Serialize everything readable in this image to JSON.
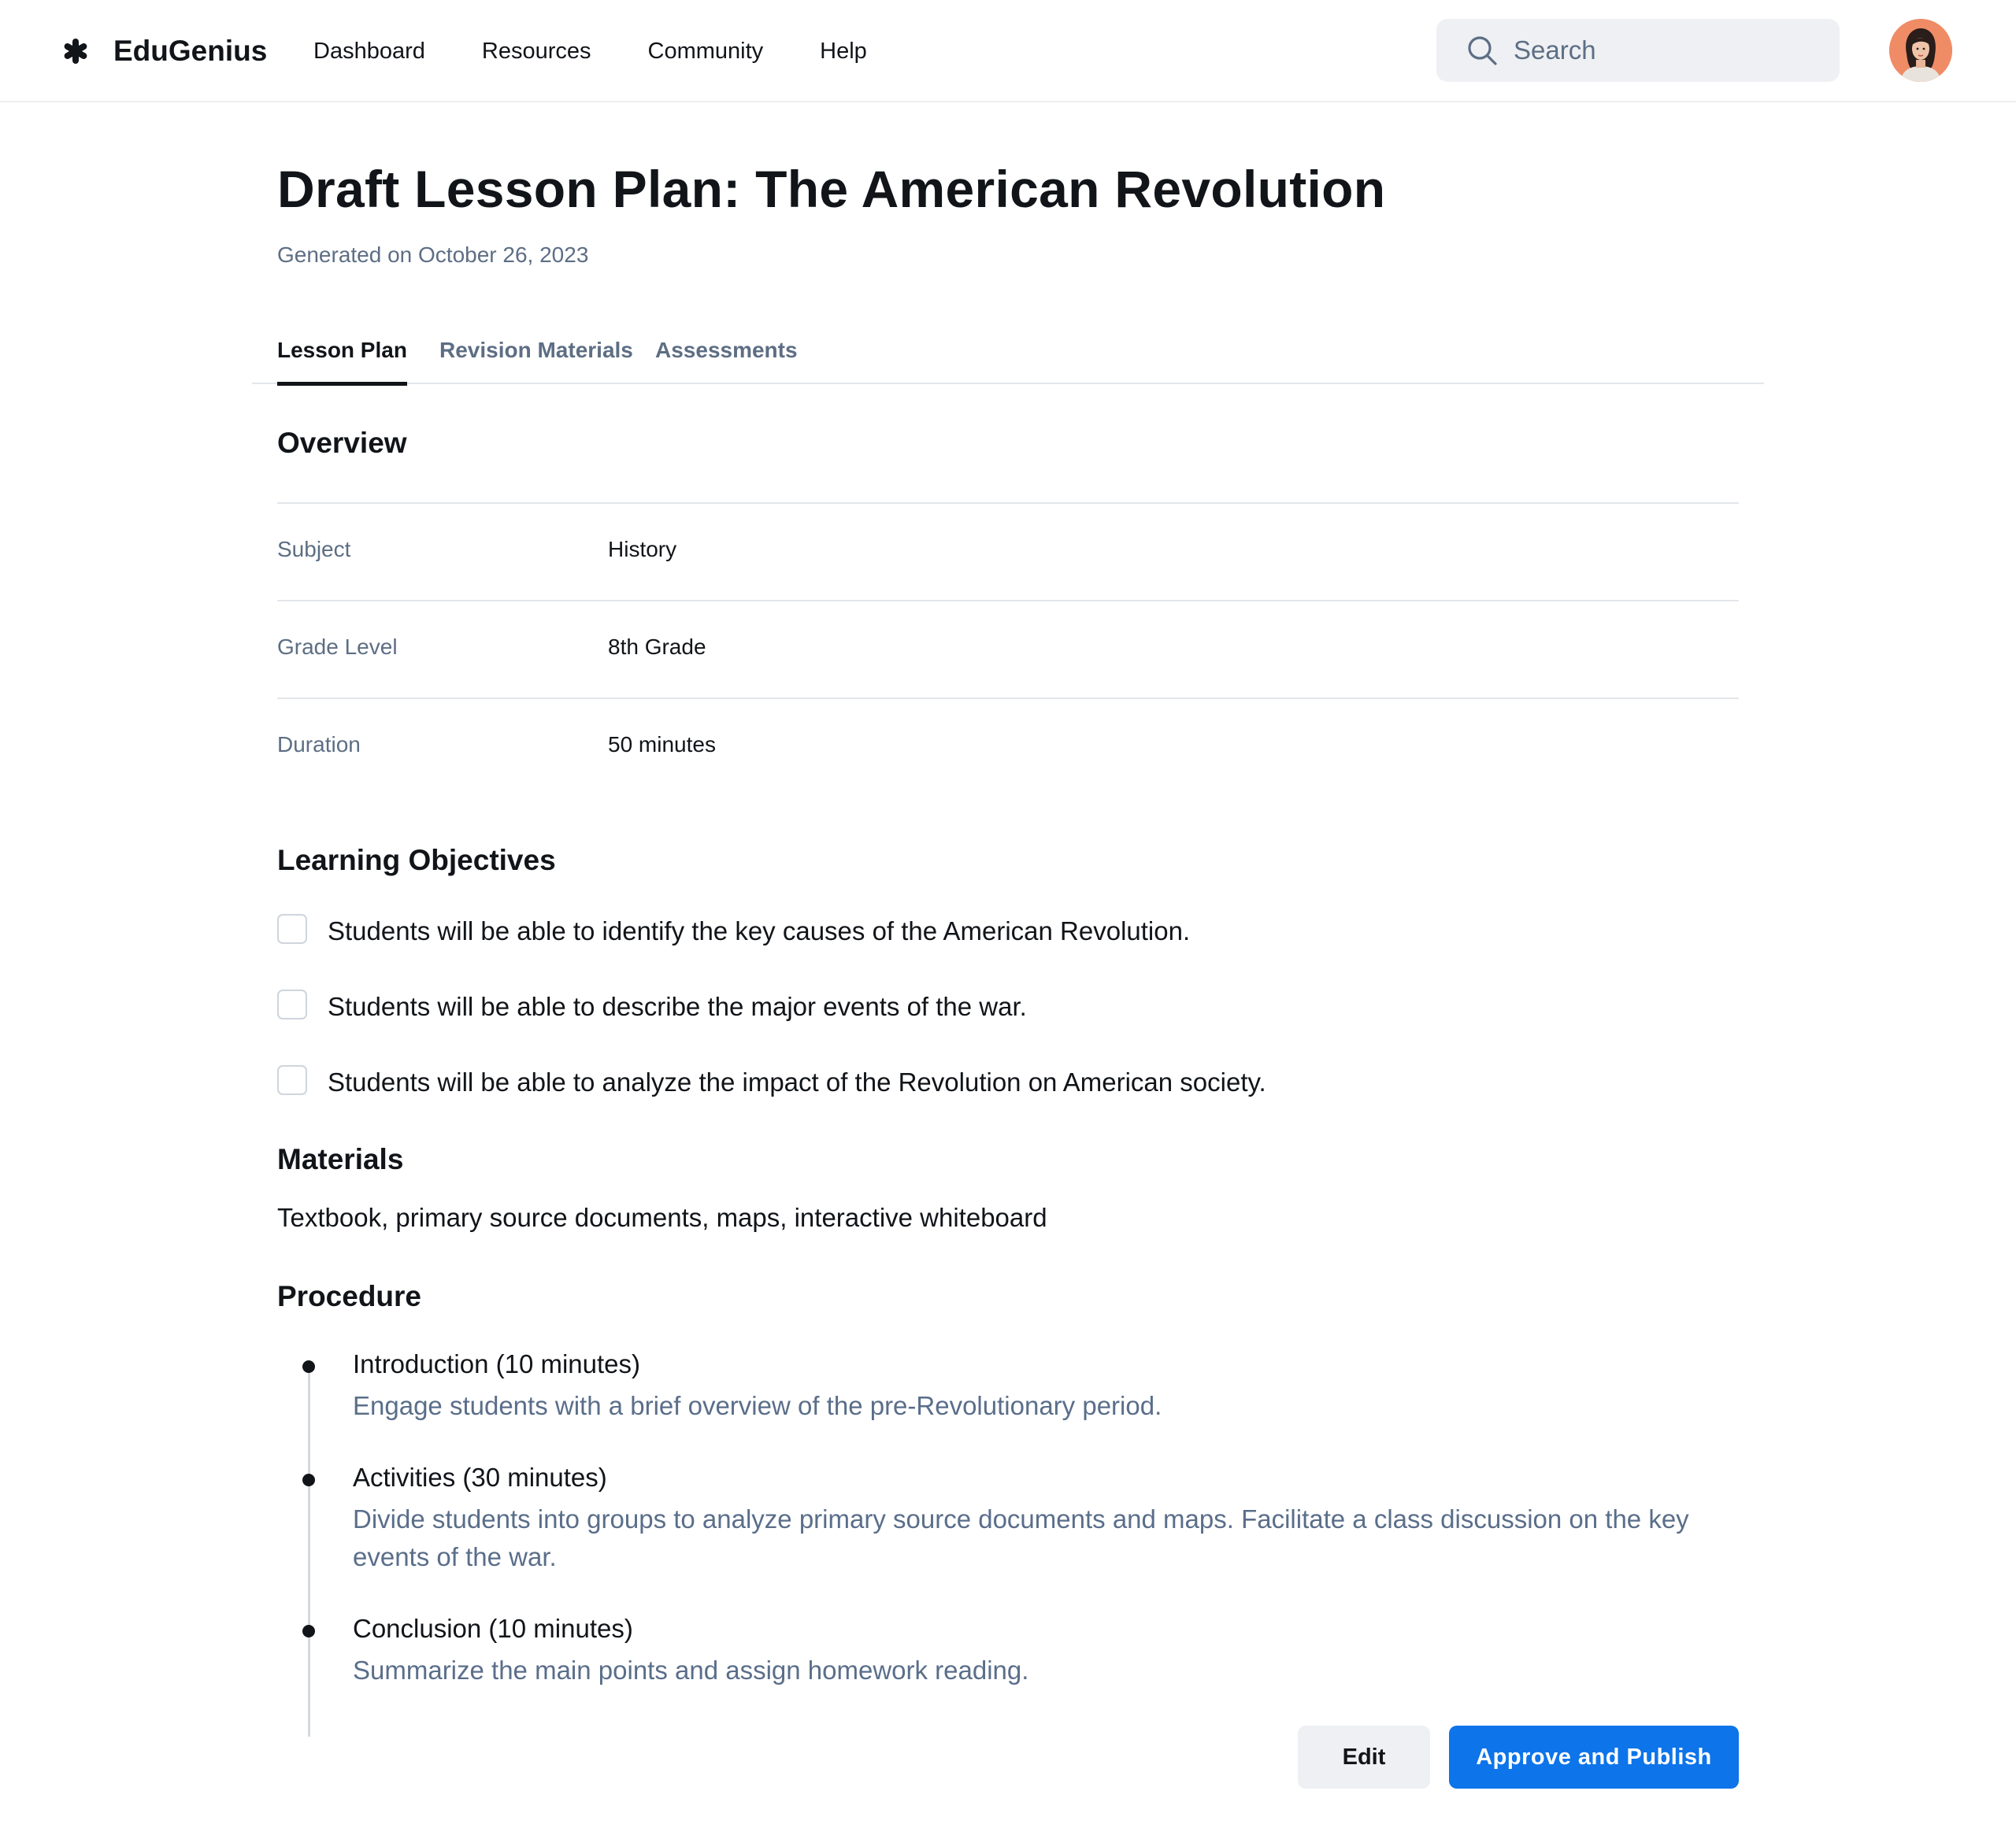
{
  "header": {
    "brand": "EduGenius",
    "nav": [
      "Dashboard",
      "Resources",
      "Community",
      "Help"
    ],
    "search_placeholder": "Search",
    "avatar_icon": "user-avatar"
  },
  "page": {
    "title": "Draft Lesson Plan: The American Revolution",
    "generated": "Generated on October 26, 2023",
    "tabs": [
      "Lesson Plan",
      "Revision Materials",
      "Assessments"
    ],
    "active_tab": "Lesson Plan"
  },
  "overview": {
    "heading": "Overview",
    "rows": [
      {
        "label": "Subject",
        "value": "History"
      },
      {
        "label": "Grade Level",
        "value": "8th Grade"
      },
      {
        "label": "Duration",
        "value": "50 minutes"
      }
    ]
  },
  "objectives": {
    "heading": "Learning Objectives",
    "items": [
      "Students will be able to identify the key causes of the American Revolution.",
      "Students will be able to describe the major events of the war.",
      "Students will be able to analyze the impact of the Revolution on American society."
    ]
  },
  "materials": {
    "heading": "Materials",
    "text": "Textbook, primary source documents, maps, interactive whiteboard"
  },
  "procedure": {
    "heading": "Procedure",
    "steps": [
      {
        "title": "Introduction (10 minutes)",
        "desc": "Engage students with a brief overview of the pre-Revolutionary period."
      },
      {
        "title": "Activities (30 minutes)",
        "desc": "Divide students into groups to analyze primary source documents and maps. Facilitate a class discussion on the key events of the war."
      },
      {
        "title": "Conclusion (10 minutes)",
        "desc": "Summarize the main points and assign homework reading."
      }
    ]
  },
  "actions": {
    "edit": "Edit",
    "approve": "Approve and Publish"
  },
  "colors": {
    "accent": "#0d74ea",
    "muted_text": "#5d6e84",
    "avatar_bg": "#ef8c66"
  }
}
